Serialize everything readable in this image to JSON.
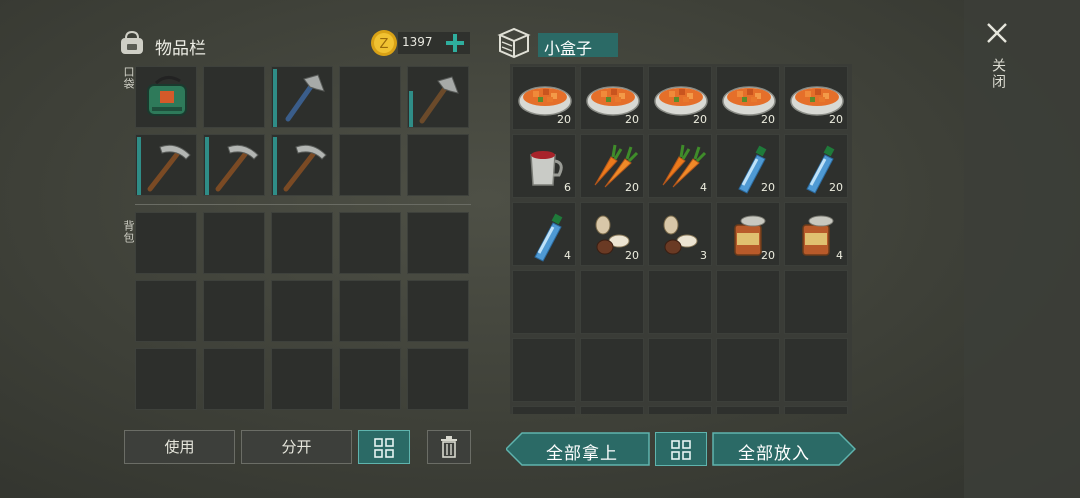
{
  "inventory": {
    "title": "物品栏",
    "coins": "1397",
    "pocket_label": "口袋",
    "backpack_label": "背包",
    "pocket_slots": [
      {
        "item": "green-backpack-icon",
        "count": ""
      },
      {
        "item": "",
        "count": ""
      },
      {
        "item": "hatchet-icon",
        "count": ""
      },
      {
        "item": "",
        "count": ""
      },
      {
        "item": "hatchet-icon",
        "count": ""
      },
      {
        "item": "pickaxe-icon",
        "count": ""
      },
      {
        "item": "pickaxe-icon",
        "count": ""
      },
      {
        "item": "pickaxe-icon",
        "count": ""
      },
      {
        "item": "",
        "count": ""
      },
      {
        "item": "",
        "count": ""
      }
    ],
    "use_label": "使用",
    "split_label": "分开"
  },
  "container": {
    "title": "小盒子",
    "slots": [
      {
        "item": "stew-bowl-icon",
        "count": "20"
      },
      {
        "item": "stew-bowl-icon",
        "count": "20"
      },
      {
        "item": "stew-bowl-icon",
        "count": "20"
      },
      {
        "item": "stew-bowl-icon",
        "count": "20"
      },
      {
        "item": "stew-bowl-icon",
        "count": "20"
      },
      {
        "item": "mug-icon",
        "count": "6"
      },
      {
        "item": "carrot-icon",
        "count": "20"
      },
      {
        "item": "carrot-icon",
        "count": "4"
      },
      {
        "item": "water-bottle-icon",
        "count": "20"
      },
      {
        "item": "water-bottle-icon",
        "count": "20"
      },
      {
        "item": "water-bottle-icon",
        "count": "4"
      },
      {
        "item": "seeds-icon",
        "count": "20"
      },
      {
        "item": "seeds-icon",
        "count": "3"
      },
      {
        "item": "tin-can-icon",
        "count": "20"
      },
      {
        "item": "tin-can-icon",
        "count": "4"
      }
    ],
    "take_all_label": "全部拿上",
    "put_all_label": "全部放入"
  },
  "close_label": "关闭",
  "colors": {
    "accent": "#2f8d87",
    "button_teal": "#2b6a66",
    "gold": "#d9a216"
  }
}
